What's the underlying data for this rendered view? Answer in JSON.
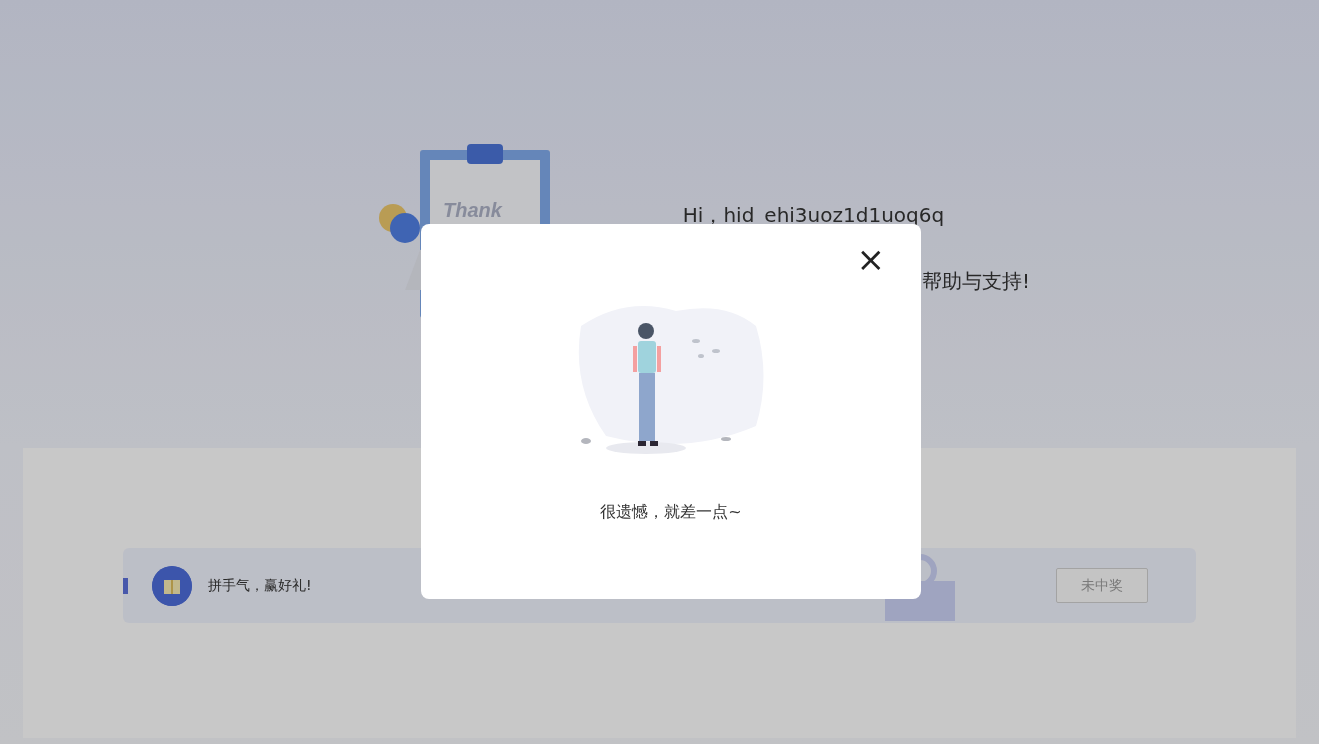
{
  "hero": {
    "clipboard_text": "Thank",
    "greeting": "Hi，hid_ehi3uoz1d1uoq6q",
    "thanks": "帮助与支持!"
  },
  "lottery": {
    "title": "拼手气，赢好礼!",
    "result_button": {
      "label": "未中奖",
      "disabled": true
    }
  },
  "modal": {
    "message": "很遗憾，就差一点~",
    "close": "×"
  }
}
